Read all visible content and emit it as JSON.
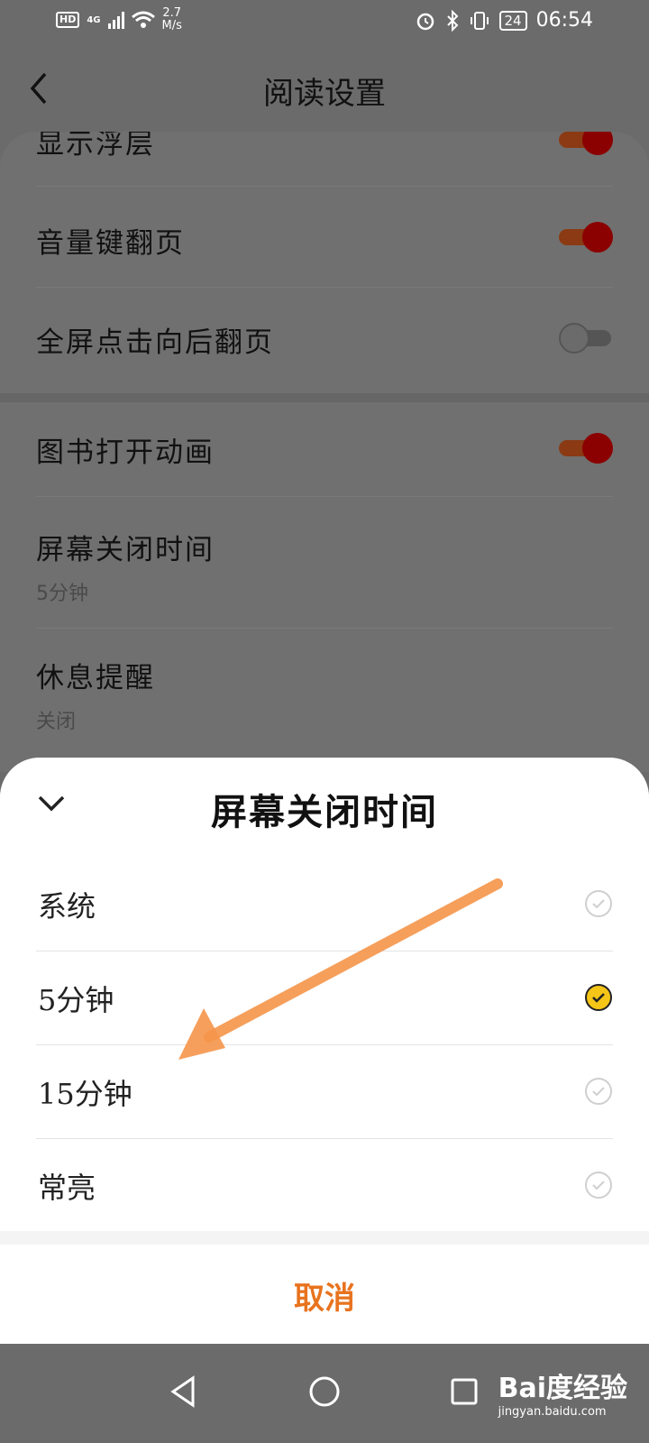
{
  "status": {
    "hd": "HD",
    "signal": "4G",
    "speed": "2.7",
    "speed_unit": "M/s",
    "battery": "24",
    "time": "06:54"
  },
  "header": {
    "title": "阅读设置"
  },
  "settings": {
    "items": [
      {
        "label": "显示浮层",
        "toggle": true
      },
      {
        "label": "音量键翻页",
        "toggle": true
      },
      {
        "label": "全屏点击向后翻页",
        "toggle": false
      },
      {
        "label": "图书打开动画",
        "toggle": true
      },
      {
        "label": "屏幕关闭时间",
        "sub": "5分钟"
      },
      {
        "label": "休息提醒",
        "sub": "关闭"
      }
    ]
  },
  "sheet": {
    "title": "屏幕关闭时间",
    "options": [
      {
        "label": "系统",
        "selected": false
      },
      {
        "label": "5分钟",
        "selected": true
      },
      {
        "label": "15分钟",
        "selected": false
      },
      {
        "label": "常亮",
        "selected": false
      }
    ],
    "cancel": "取消"
  },
  "watermark": {
    "brand": "Bai度经验",
    "url": "jingyan.baidu.com"
  },
  "colors": {
    "accent": "#e8731e",
    "selected_check": "#f5c518",
    "toggle_on": "#8b0000",
    "arrow": "#f5954a"
  }
}
